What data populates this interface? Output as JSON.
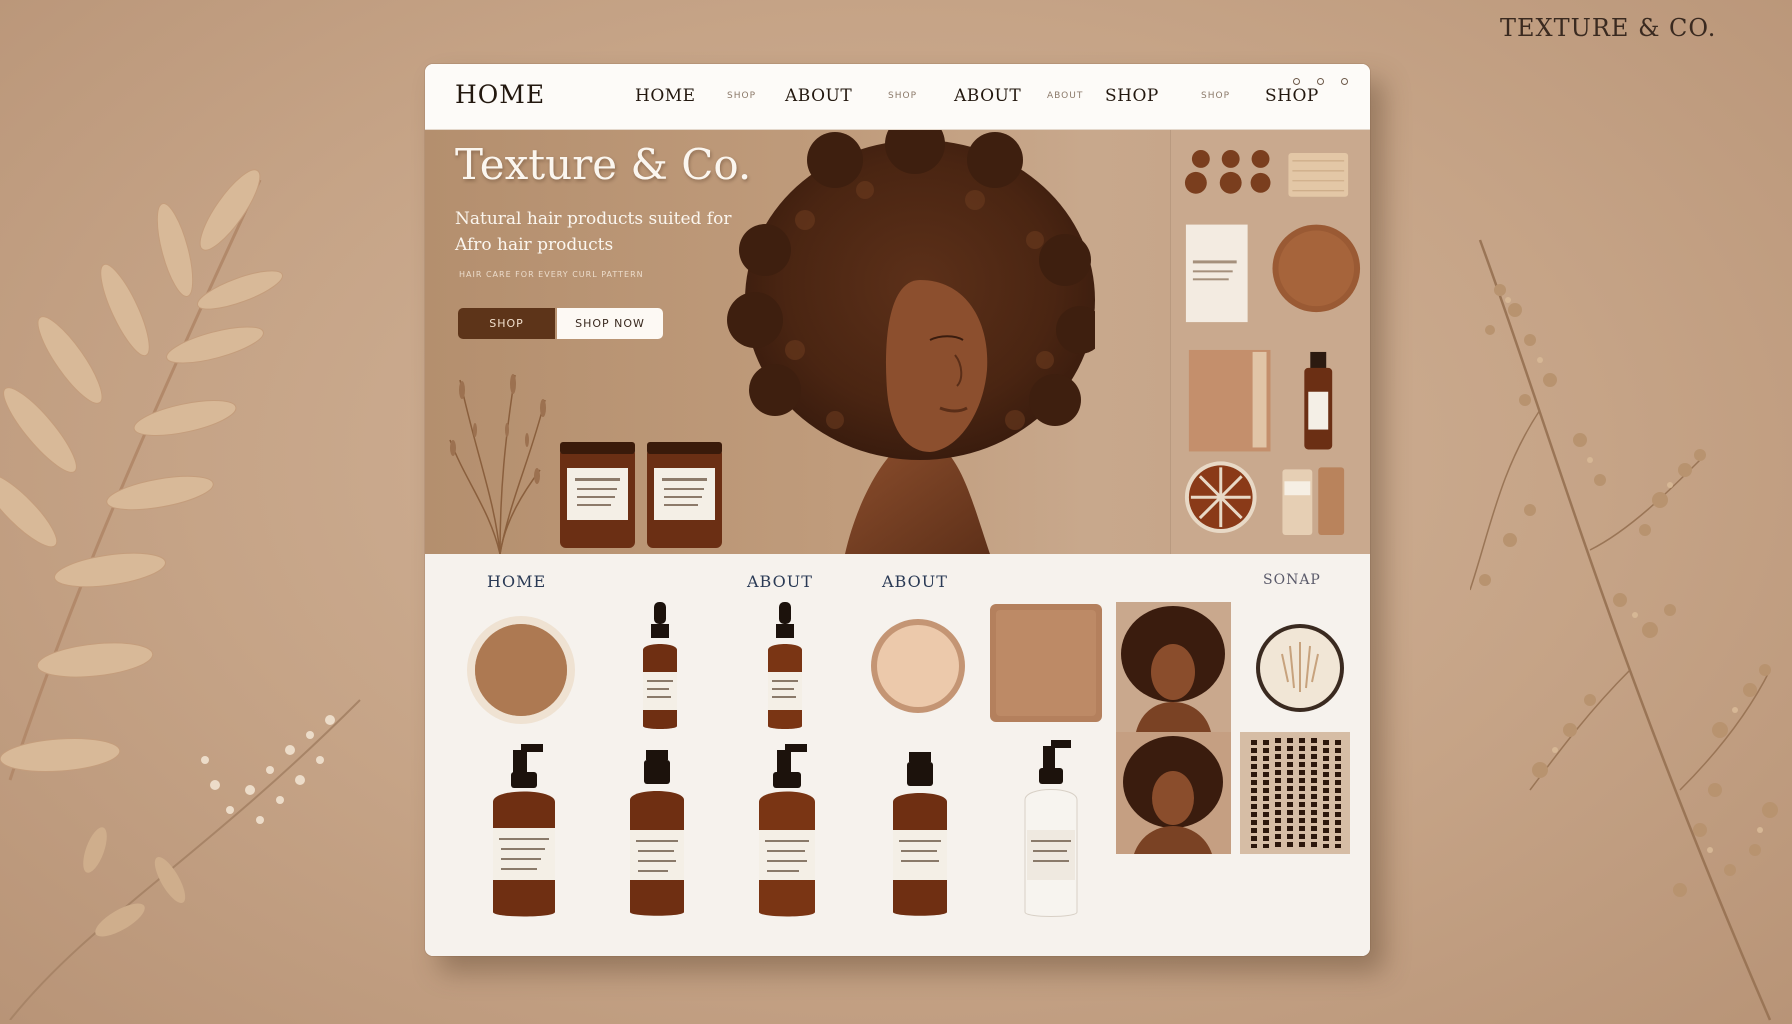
{
  "brand_corner": "TEXTURE & CO.",
  "window": {
    "logo": "HOME",
    "nav": {
      "links": [
        "HOME",
        "ABOUT",
        "ABOUT",
        "SHOP",
        "SHOP"
      ],
      "separators": [
        "SHOP",
        "SHOP",
        "ABOUT",
        "SHOP"
      ]
    }
  },
  "hero": {
    "title": "Texture & Co.",
    "subtitle": "Natural hair products suited for Afro hair products",
    "fineprint": "HAIR CARE FOR EVERY CURL PATTERN",
    "primary_button": "SHOP",
    "secondary_button": "SHOP NOW"
  },
  "products": {
    "tabs": [
      "HOME",
      "ABOUT",
      "ABOUT",
      "SONAP"
    ]
  },
  "colors": {
    "background": "#c6a487",
    "accent_brown": "#5d3419",
    "tab_navy": "#2a3a55",
    "amber_bottle": "#6b2f14"
  }
}
